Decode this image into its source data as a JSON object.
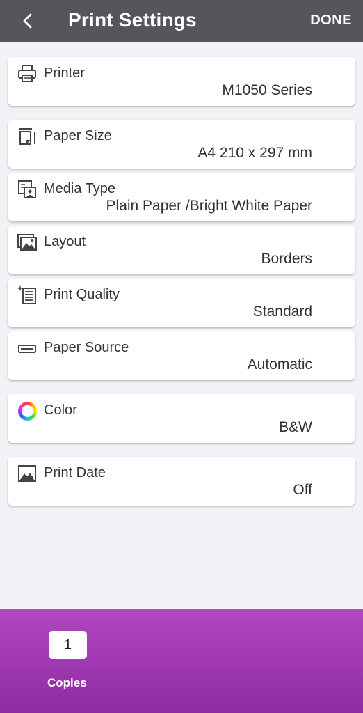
{
  "header": {
    "title": "Print Settings",
    "done_label": "DONE"
  },
  "settings": {
    "printer": {
      "label": "Printer",
      "value": "M1050 Series",
      "icon": "printer-icon"
    },
    "paper_size": {
      "label": "Paper Size",
      "value": "A4 210 x 297 mm",
      "icon": "paper-size-icon"
    },
    "media_type": {
      "label": "Media Type",
      "value": "Plain Paper /Bright White Paper",
      "icon": "media-type-icon"
    },
    "layout": {
      "label": "Layout",
      "value": "Borders",
      "icon": "layout-icon"
    },
    "print_quality": {
      "label": "Print Quality",
      "value": "Standard",
      "icon": "print-quality-icon"
    },
    "paper_source": {
      "label": "Paper Source",
      "value": "Automatic",
      "icon": "paper-source-icon"
    },
    "color": {
      "label": "Color",
      "value": "B&W",
      "icon": "color-wheel-icon"
    },
    "print_date": {
      "label": "Print Date",
      "value": "Off",
      "icon": "print-date-icon"
    }
  },
  "copies": {
    "value": "1",
    "label": "Copies"
  },
  "colors": {
    "header_bg": "#55565b",
    "page_bg": "#f2f1f6",
    "accent_purple": "#a23bb6"
  }
}
